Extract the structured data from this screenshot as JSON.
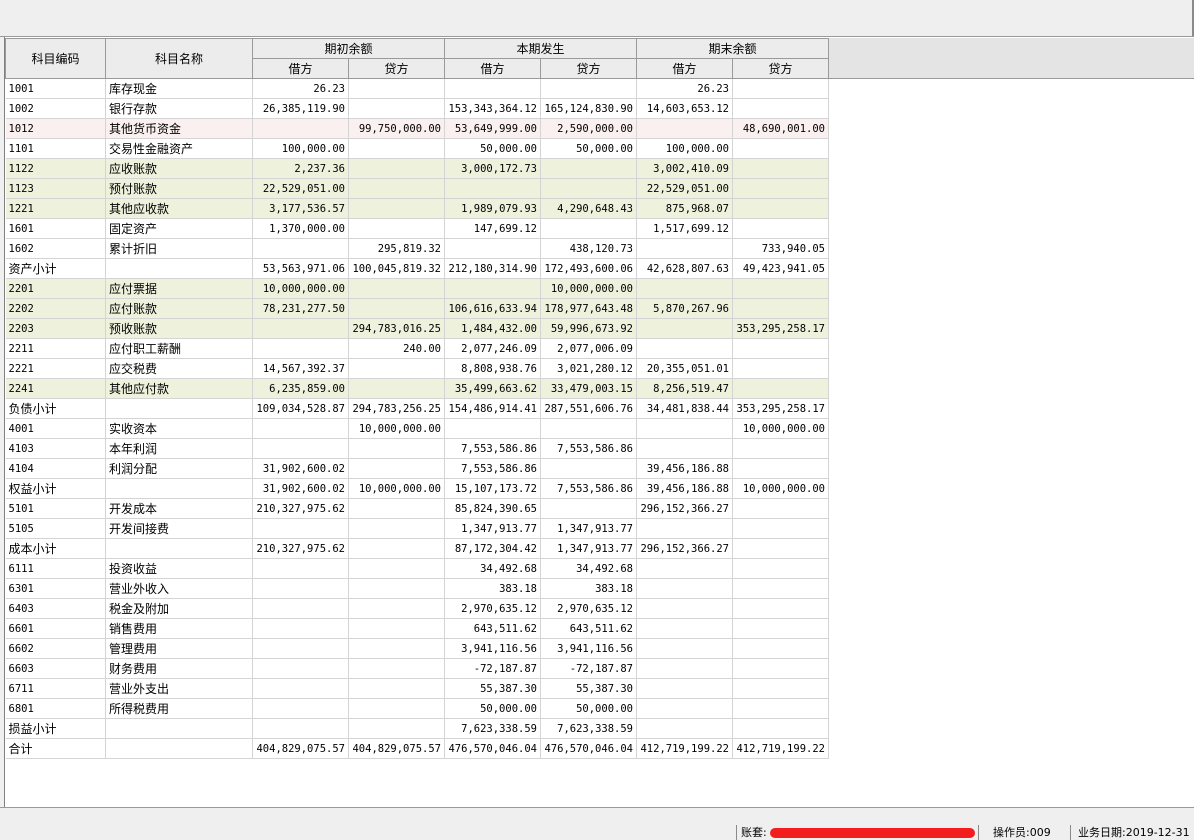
{
  "header": {
    "code": "科目编码",
    "name": "科目名称",
    "groups": [
      "期初余额",
      "本期发生",
      "期末余额"
    ],
    "debit": "借方",
    "credit": "贷方"
  },
  "rows": [
    {
      "code": "1001",
      "name": "库存现金",
      "v": [
        "26.23",
        "",
        "",
        "",
        "26.23",
        ""
      ],
      "hl": ""
    },
    {
      "code": "1002",
      "name": "银行存款",
      "v": [
        "26,385,119.90",
        "",
        "153,343,364.12",
        "165,124,830.90",
        "14,603,653.12",
        ""
      ],
      "hl": ""
    },
    {
      "code": "1012",
      "name": "其他货币资金",
      "v": [
        "",
        "99,750,000.00",
        "53,649,999.00",
        "2,590,000.00",
        "",
        "48,690,001.00"
      ],
      "hl": "pink"
    },
    {
      "code": "1101",
      "name": "交易性金融资产",
      "v": [
        "100,000.00",
        "",
        "50,000.00",
        "50,000.00",
        "100,000.00",
        ""
      ],
      "hl": ""
    },
    {
      "code": "1122",
      "name": "应收账款",
      "v": [
        "2,237.36",
        "",
        "3,000,172.73",
        "",
        "3,002,410.09",
        ""
      ],
      "hl": "green"
    },
    {
      "code": "1123",
      "name": "预付账款",
      "v": [
        "22,529,051.00",
        "",
        "",
        "",
        "22,529,051.00",
        ""
      ],
      "hl": "green"
    },
    {
      "code": "1221",
      "name": "其他应收款",
      "v": [
        "3,177,536.57",
        "",
        "1,989,079.93",
        "4,290,648.43",
        "875,968.07",
        ""
      ],
      "hl": "green"
    },
    {
      "code": "1601",
      "name": "固定资产",
      "v": [
        "1,370,000.00",
        "",
        "147,699.12",
        "",
        "1,517,699.12",
        ""
      ],
      "hl": ""
    },
    {
      "code": "1602",
      "name": "累计折旧",
      "v": [
        "",
        "295,819.32",
        "",
        "438,120.73",
        "",
        "733,940.05"
      ],
      "hl": ""
    },
    {
      "code": "资产小计",
      "name": "",
      "v": [
        "53,563,971.06",
        "100,045,819.32",
        "212,180,314.90",
        "172,493,600.06",
        "42,628,807.63",
        "49,423,941.05"
      ],
      "hl": "",
      "sub": true
    },
    {
      "code": "2201",
      "name": "应付票据",
      "v": [
        "10,000,000.00",
        "",
        "",
        "10,000,000.00",
        "",
        ""
      ],
      "hl": "green"
    },
    {
      "code": "2202",
      "name": "应付账款",
      "v": [
        "78,231,277.50",
        "",
        "106,616,633.94",
        "178,977,643.48",
        "5,870,267.96",
        ""
      ],
      "hl": "green"
    },
    {
      "code": "2203",
      "name": "预收账款",
      "v": [
        "",
        "294,783,016.25",
        "1,484,432.00",
        "59,996,673.92",
        "",
        "353,295,258.17"
      ],
      "hl": "green"
    },
    {
      "code": "2211",
      "name": "应付职工薪酬",
      "v": [
        "",
        "240.00",
        "2,077,246.09",
        "2,077,006.09",
        "",
        ""
      ],
      "hl": ""
    },
    {
      "code": "2221",
      "name": "应交税费",
      "v": [
        "14,567,392.37",
        "",
        "8,808,938.76",
        "3,021,280.12",
        "20,355,051.01",
        ""
      ],
      "hl": ""
    },
    {
      "code": "2241",
      "name": "其他应付款",
      "v": [
        "6,235,859.00",
        "",
        "35,499,663.62",
        "33,479,003.15",
        "8,256,519.47",
        ""
      ],
      "hl": "green"
    },
    {
      "code": "负债小计",
      "name": "",
      "v": [
        "109,034,528.87",
        "294,783,256.25",
        "154,486,914.41",
        "287,551,606.76",
        "34,481,838.44",
        "353,295,258.17"
      ],
      "hl": "",
      "sub": true
    },
    {
      "code": "4001",
      "name": "实收资本",
      "v": [
        "",
        "10,000,000.00",
        "",
        "",
        "",
        "10,000,000.00"
      ],
      "hl": ""
    },
    {
      "code": "4103",
      "name": "本年利润",
      "v": [
        "",
        "",
        "7,553,586.86",
        "7,553,586.86",
        "",
        ""
      ],
      "hl": ""
    },
    {
      "code": "4104",
      "name": "利润分配",
      "v": [
        "31,902,600.02",
        "",
        "7,553,586.86",
        "",
        "39,456,186.88",
        ""
      ],
      "hl": ""
    },
    {
      "code": "权益小计",
      "name": "",
      "v": [
        "31,902,600.02",
        "10,000,000.00",
        "15,107,173.72",
        "7,553,586.86",
        "39,456,186.88",
        "10,000,000.00"
      ],
      "hl": "",
      "sub": true
    },
    {
      "code": "5101",
      "name": "开发成本",
      "v": [
        "210,327,975.62",
        "",
        "85,824,390.65",
        "",
        "296,152,366.27",
        ""
      ],
      "hl": ""
    },
    {
      "code": "5105",
      "name": "开发间接费",
      "v": [
        "",
        "",
        "1,347,913.77",
        "1,347,913.77",
        "",
        ""
      ],
      "hl": ""
    },
    {
      "code": "成本小计",
      "name": "",
      "v": [
        "210,327,975.62",
        "",
        "87,172,304.42",
        "1,347,913.77",
        "296,152,366.27",
        ""
      ],
      "hl": "",
      "sub": true
    },
    {
      "code": "6111",
      "name": "投资收益",
      "v": [
        "",
        "",
        "34,492.68",
        "34,492.68",
        "",
        ""
      ],
      "hl": ""
    },
    {
      "code": "6301",
      "name": "营业外收入",
      "v": [
        "",
        "",
        "383.18",
        "383.18",
        "",
        ""
      ],
      "hl": ""
    },
    {
      "code": "6403",
      "name": "税金及附加",
      "v": [
        "",
        "",
        "2,970,635.12",
        "2,970,635.12",
        "",
        ""
      ],
      "hl": ""
    },
    {
      "code": "6601",
      "name": "销售费用",
      "v": [
        "",
        "",
        "643,511.62",
        "643,511.62",
        "",
        ""
      ],
      "hl": ""
    },
    {
      "code": "6602",
      "name": "管理费用",
      "v": [
        "",
        "",
        "3,941,116.56",
        "3,941,116.56",
        "",
        ""
      ],
      "hl": ""
    },
    {
      "code": "6603",
      "name": "财务费用",
      "v": [
        "",
        "",
        "-72,187.87",
        "-72,187.87",
        "",
        ""
      ],
      "hl": ""
    },
    {
      "code": "6711",
      "name": "营业外支出",
      "v": [
        "",
        "",
        "55,387.30",
        "55,387.30",
        "",
        ""
      ],
      "hl": ""
    },
    {
      "code": "6801",
      "name": "所得税费用",
      "v": [
        "",
        "",
        "50,000.00",
        "50,000.00",
        "",
        ""
      ],
      "hl": ""
    },
    {
      "code": "损益小计",
      "name": "",
      "v": [
        "",
        "",
        "7,623,338.59",
        "7,623,338.59",
        "",
        ""
      ],
      "hl": "",
      "sub": true
    },
    {
      "code": "合计",
      "name": "",
      "v": [
        "404,829,075.57",
        "404,829,075.57",
        "476,570,046.04",
        "476,570,046.04",
        "412,719,199.22",
        "412,719,199.22"
      ],
      "hl": "",
      "sub": true
    }
  ],
  "status": {
    "account_label": "账套:",
    "operator": "操作员:009",
    "business_date": "业务日期:2019-12-31"
  },
  "colors": {
    "highlight_green": "#eef1dc",
    "highlight_pink": "#fbf0f0",
    "redaction": "#f41d1d"
  }
}
